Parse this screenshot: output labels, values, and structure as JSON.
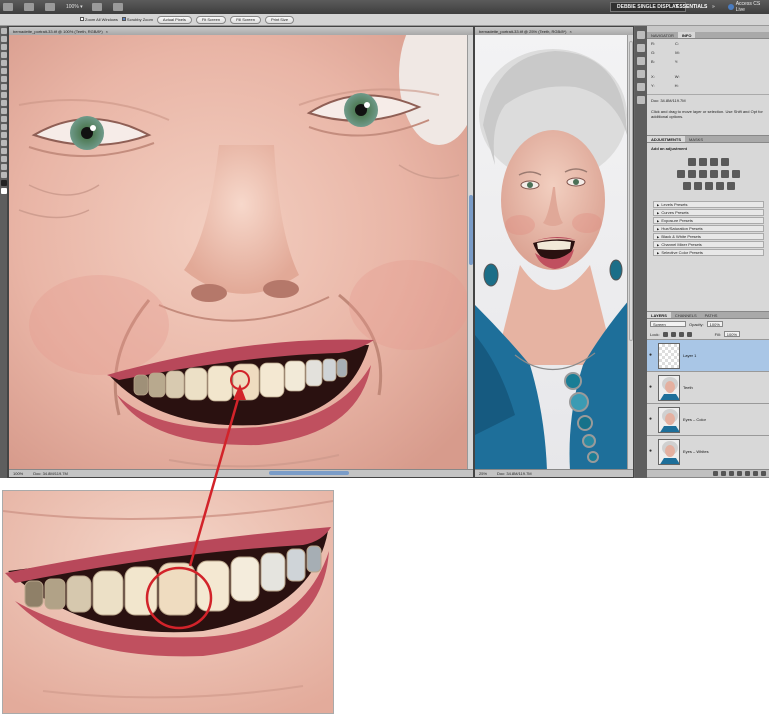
{
  "app_bar": {
    "zoom": "100%",
    "workspace_button": "DEBBIE SINGLE DISPLAY",
    "essentials": "ESSENTIALS",
    "more": "»",
    "cs_live": "Access CS Live"
  },
  "options_bar": {
    "zoom_all_windows": "Zoom All Windows",
    "scrubby_zoom": "Scrubby Zoom",
    "buttons": [
      "Actual Pixels",
      "Fit Screen",
      "Fill Screen",
      "Print Size"
    ]
  },
  "doc1": {
    "tab": "bernadette_portrait-33.tif @ 100% (Teeth, RGB/8*)",
    "zoom": "100%",
    "doc_size": "Doc: 34.8M/119.7M"
  },
  "doc2": {
    "tab": "bernadette_portrait-33.tif @ 25% (Teeth, RGB/8*)",
    "zoom": "25%",
    "doc_size": "Doc: 34.8M/119.7M"
  },
  "nav_panel": {
    "tabs": [
      "NAVIGATOR",
      "INFO"
    ],
    "info_rows": [
      [
        "R:",
        "C:"
      ],
      [
        "G:",
        "M:"
      ],
      [
        "B:",
        "Y:"
      ],
      [
        "X:",
        "W:"
      ],
      [
        "Y:",
        "H:"
      ]
    ],
    "doc_size": "Doc: 34.8M/119.7M",
    "message": "Click and drag to move layer or selection. Use Shift and Opt for additional options."
  },
  "adj_panel": {
    "tabs": [
      "ADJUSTMENTS",
      "MASKS"
    ],
    "title": "Add an adjustment",
    "presets": [
      "Levels Presets",
      "Curves Presets",
      "Exposure Presets",
      "Hue/Saturation Presets",
      "Black & White Presets",
      "Channel Mixer Presets",
      "Selective Color Presets"
    ]
  },
  "layers_panel": {
    "tabs": [
      "LAYERS",
      "CHANNELS",
      "PATHS"
    ],
    "blend_mode": "Screen",
    "opacity_label": "Opacity:",
    "opacity": "100%",
    "lock_label": "Lock:",
    "fill_label": "Fill:",
    "fill": "100%",
    "layers": [
      {
        "name": "Layer 1",
        "active": true,
        "kind": "empty"
      },
      {
        "name": "Teeth",
        "active": false,
        "kind": "portrait"
      },
      {
        "name": "Eyes – Color",
        "active": false,
        "kind": "portrait"
      },
      {
        "name": "Eyes – Whites",
        "active": false,
        "kind": "portrait"
      }
    ]
  },
  "colors": {
    "annotation": "#d2232a",
    "selection_blue": "#a9c6e6",
    "shirt_teal": "#1e6f9a"
  }
}
